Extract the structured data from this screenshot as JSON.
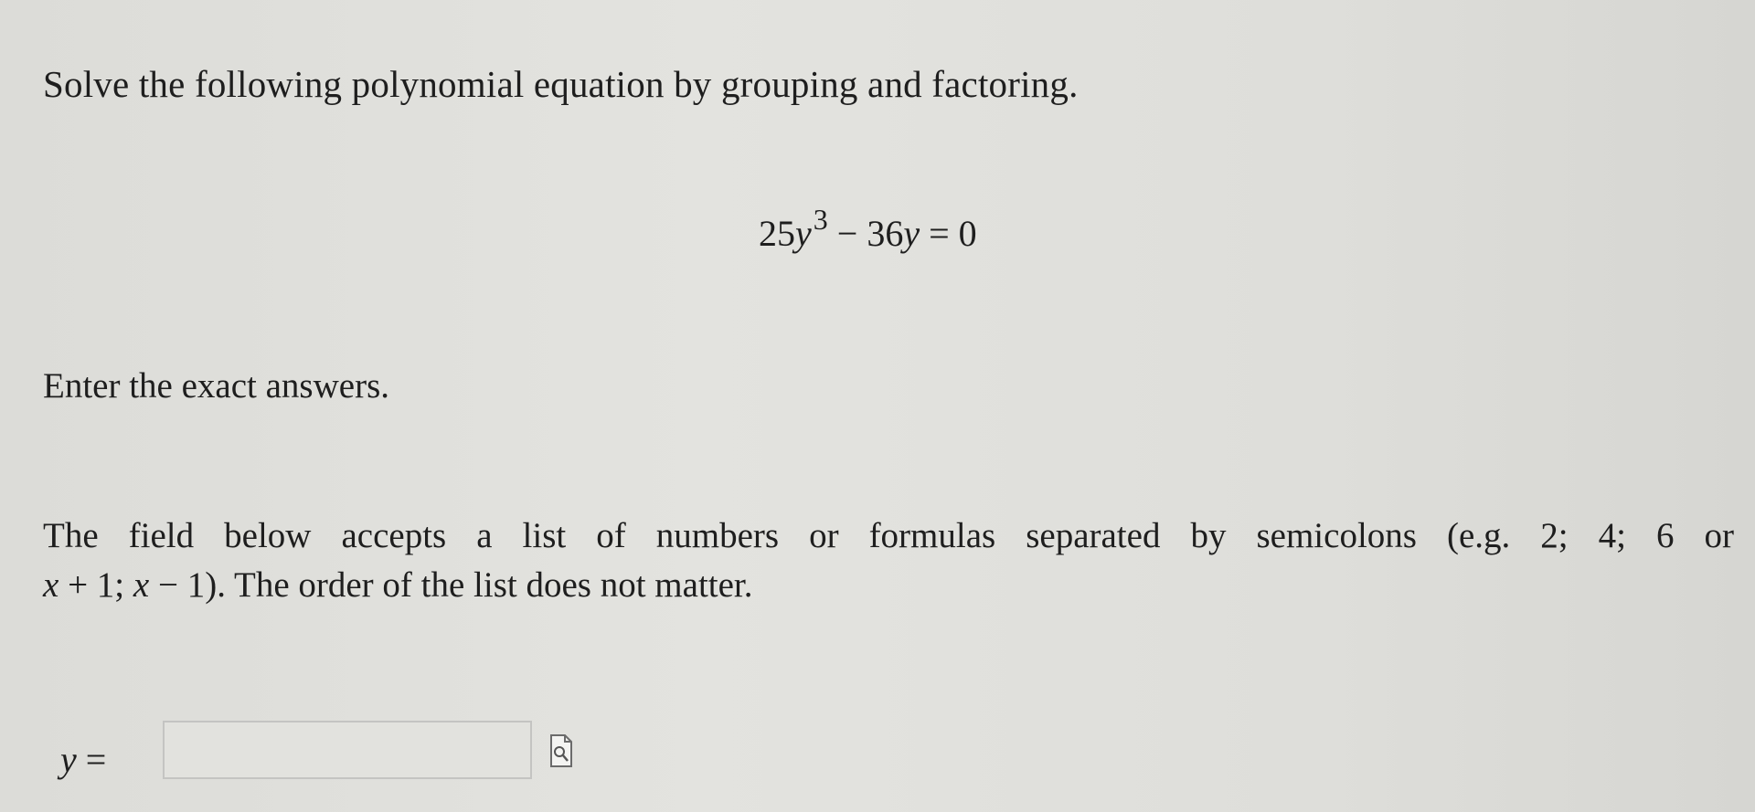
{
  "question": {
    "title": "Solve the following polynomial equation by grouping and factoring.",
    "equation": {
      "coef1": "25",
      "var": "y",
      "exponent": "3",
      "op": "−",
      "term2": "36",
      "rhs": "= 0"
    },
    "instruction": "Enter the exact answers.",
    "note_line1": "The field below accepts a list of numbers or formulas separated by semicolons (e.g. 2; 4; 6 or",
    "note_line2": {
      "a": "x",
      "b": " + 1; ",
      "c": "x",
      "d": " − 1). The order of the list does not matter."
    }
  },
  "answer": {
    "var": "y",
    "eq": " =",
    "value": "",
    "placeholder": ""
  },
  "icons": {
    "preview": "document-magnifier-icon"
  }
}
